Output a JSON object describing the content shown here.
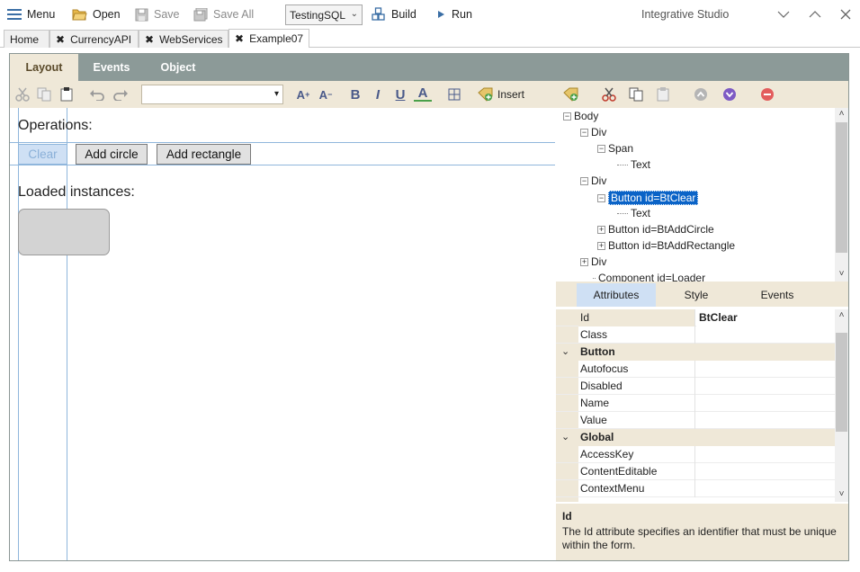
{
  "toolbar": {
    "menu": "Menu",
    "open": "Open",
    "save": "Save",
    "save_all": "Save All",
    "project": "TestingSQL",
    "build": "Build",
    "run": "Run"
  },
  "app_title": "Integrative Studio",
  "doc_tabs": [
    "Home",
    "CurrencyAPI",
    "WebServices",
    "Example07"
  ],
  "panel_tabs": [
    "Layout",
    "Events",
    "Object"
  ],
  "design_toolbar": {
    "bold": "B",
    "italic": "I",
    "underline": "U",
    "font_color": "A",
    "insert": "Insert"
  },
  "canvas": {
    "operations_label": "Operations:",
    "buttons": [
      "Clear",
      "Add circle",
      "Add rectangle"
    ],
    "loaded_label": "Loaded instances:"
  },
  "tree": {
    "nodes": [
      "Body",
      "Div",
      "Span",
      "Text",
      "Div",
      "Button id=BtClear",
      "Text",
      "Button id=BtAddCircle",
      "Button id=BtAddRectangle",
      "Div",
      "Component id=Loader"
    ]
  },
  "prop_tabs": [
    "Attributes",
    "Style",
    "Events"
  ],
  "properties": {
    "id_name": "Id",
    "id_value": "BtClear",
    "class_name": "Class",
    "group_button": "Button",
    "autofocus": "Autofocus",
    "disabled": "Disabled",
    "name": "Name",
    "value": "Value",
    "group_global": "Global",
    "accesskey": "AccessKey",
    "contenteditable": "ContentEditable",
    "contextmenu": "ContextMenu"
  },
  "description": {
    "title": "Id",
    "text": "The Id attribute specifies an identifier that must be unique within the form."
  },
  "colors": {
    "panel_tab_bar": "#8c9a98",
    "beige": "#efe8d8",
    "selection": "#0a63c7",
    "guide": "#8fb6dc"
  }
}
